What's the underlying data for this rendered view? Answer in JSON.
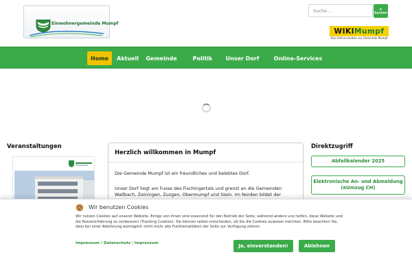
{
  "header": {
    "logo_text": "Einwohnergemeinde Mumpf",
    "search": {
      "placeholder": "Suche ...",
      "button_label": "Suchen"
    },
    "wiki_logo": {
      "part1": "WIKI",
      "part2": "Mumpf",
      "subtitle": "Das Online-Lexikon zur Gemeinde Mumpf"
    }
  },
  "nav": {
    "items": [
      {
        "label": "Home"
      },
      {
        "label": "Aktuell"
      },
      {
        "label": "Gemeinde"
      },
      {
        "label": "Politik"
      },
      {
        "label": "Unser Dorf"
      },
      {
        "label": "Online-Services"
      }
    ]
  },
  "events": {
    "title": "Veranstaltungen"
  },
  "welcome": {
    "title": "Herzlich willkommen in Mumpf",
    "p1": "Die Gemeinde Mumpf ist ein freundliches und belebtes Dorf.",
    "p2": "Unser Dorf liegt am Fusse des Fischingertals und grenzt an die Gemeinden Wallbach, Zeiningen, Zuzgen, Obermumpf und Stein. Im Norden bildet der"
  },
  "direct": {
    "title": "Direktzugriff",
    "links": [
      {
        "label": "Abfallkalender 2025"
      },
      {
        "label": "Elektronische An- und Abmeldung (eUmzug CH)"
      }
    ]
  },
  "cookie": {
    "title": "Wir benutzen Cookies",
    "text": "Wir nutzen Cookies auf unserer Website. Einige von ihnen sind essenziell für den Betrieb der Seite, während andere uns helfen, diese Website und die Nutzererfahrung zu verbessern (Tracking Cookies). Sie können selbst entscheiden, ob Sie die Cookies zulassen möchten. Bitte beachten Sie, dass bei einer Ablehnung womöglich nicht mehr alle Funktionalitäten der Seite zur Verfügung stehen.",
    "link1": "Impressum / Datenschutz",
    "separator": "|",
    "link2": "Impressum",
    "accept_label": "Ja, einverstanden!",
    "reject_label": "Ablehnen"
  },
  "colors": {
    "brand_green": "#3bab4a",
    "nav_active": "#f2c200",
    "wiki_yellow": "#f4d000"
  }
}
